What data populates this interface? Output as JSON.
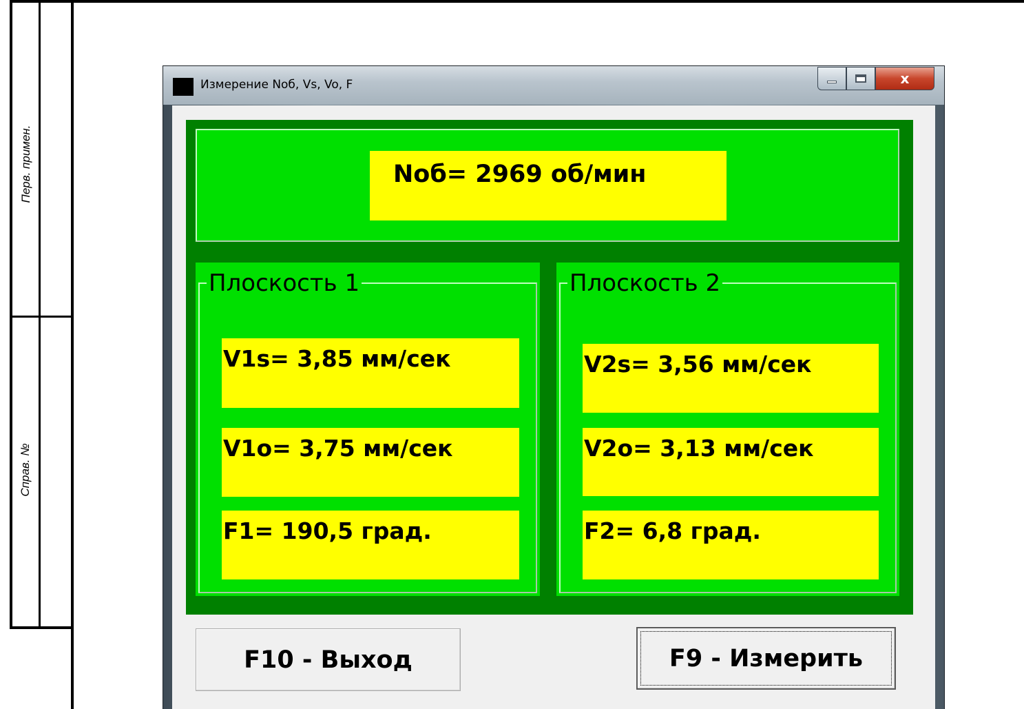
{
  "sheet": {
    "stamp_labels": [
      "Перв. примен.",
      "Справ. №"
    ]
  },
  "window": {
    "title": "Измерение Noб, Vs, Vo, F",
    "close_glyph": "x"
  },
  "rpm": {
    "text": "Noб= 2969 об/мин"
  },
  "plane1": {
    "label": "Плоскость 1",
    "vs": "V1s= 3,85 мм/сек",
    "vo": "V1o= 3,75 мм/сек",
    "f": "F1= 190,5 град."
  },
  "plane2": {
    "label": "Плоскость 2",
    "vs": "V2s= 3,56 мм/сек",
    "vo": "V2o= 3,13 мм/сек",
    "f": "F2= 6,8 град."
  },
  "buttons": {
    "exit": "F10 - Выход",
    "measure": "F9 - Измерить"
  },
  "colors": {
    "panel_dark": "#008000",
    "panel_light": "#00e000",
    "value_bg": "#ffff00"
  }
}
